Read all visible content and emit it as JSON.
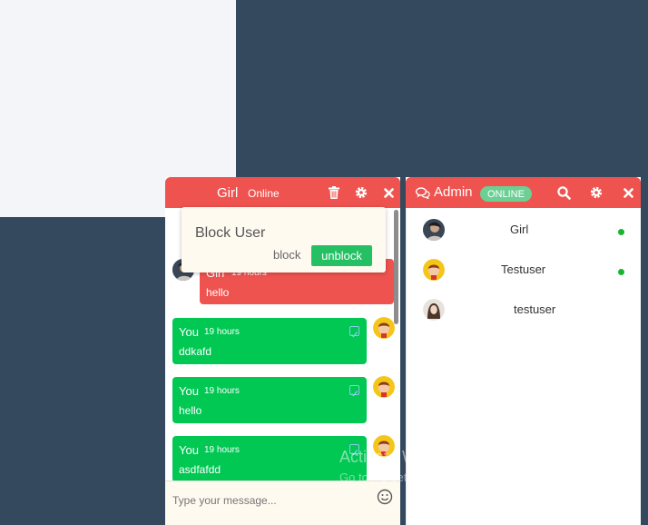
{
  "chat": {
    "name": "Girl",
    "status": "Online",
    "input_placeholder": "Type your message...",
    "messages": [
      {
        "who": "Girl",
        "time": "19 hours",
        "text": "hello"
      },
      {
        "who": "You",
        "time": "19 hours",
        "text": "ddkafd"
      },
      {
        "who": "You",
        "time": "19 hours",
        "text": "hello"
      },
      {
        "who": "You",
        "time": "19 hours",
        "text": "asdfafdd"
      }
    ]
  },
  "popup": {
    "title": "Block User",
    "block_label": "block",
    "unblock_label": "unblock"
  },
  "admin": {
    "title": "Admin",
    "status": "ONLINE",
    "users": [
      {
        "name": "Girl",
        "online": true
      },
      {
        "name": "Testuser",
        "online": true
      },
      {
        "name": "testuser",
        "online": false
      }
    ]
  },
  "watermark": {
    "title": "Activate Windows",
    "subtitle": "Go to PC settings to activate Windows."
  },
  "colors": {
    "header_red": "#ef5350",
    "sent_green": "#00c853",
    "online_dot": "#18b532",
    "background": "#34495e"
  },
  "icons": [
    "trash-icon",
    "gear-icon",
    "close-icon",
    "search-icon",
    "chat-bubbles-icon",
    "smiley-icon",
    "check-icon"
  ]
}
